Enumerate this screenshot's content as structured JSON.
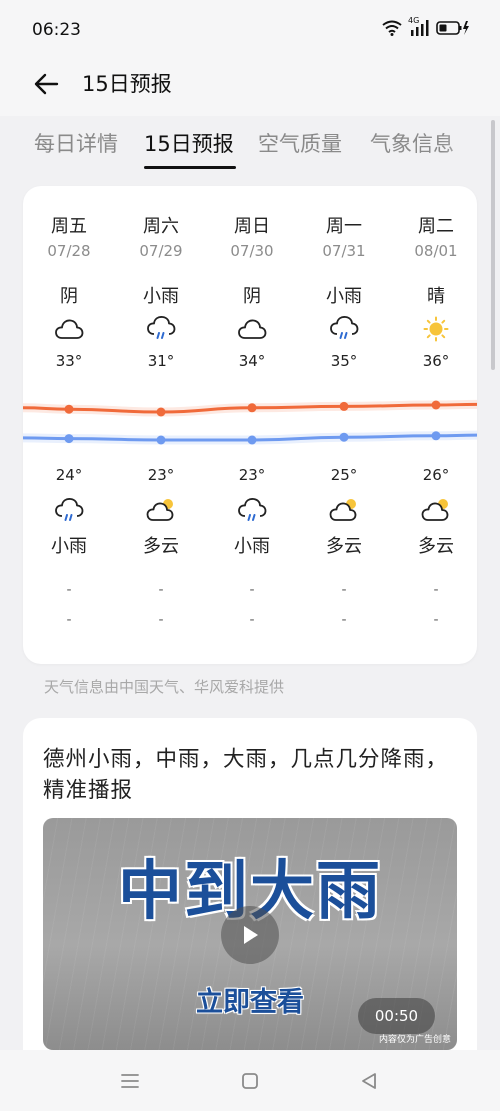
{
  "status_bar": {
    "time": "06:23",
    "network": "4G",
    "wifi_icon": "wifi-icon",
    "signal_icon": "signal-icon",
    "battery_icon": "battery-charging-icon"
  },
  "header": {
    "title": "15日预报",
    "back_icon": "arrow-left-icon"
  },
  "tabs": [
    {
      "label": "每日详情",
      "active": false
    },
    {
      "label": "15日预报",
      "active": true
    },
    {
      "label": "空气质量",
      "active": false
    },
    {
      "label": "气象信息",
      "active": false
    }
  ],
  "forecast": {
    "days": [
      {
        "weekday": "周五",
        "date": "07/28",
        "day_condition": "阴",
        "day_icon": "cloudy-icon",
        "high": "33°",
        "low": "24°",
        "night_icon": "light-rain-icon",
        "night_condition": "小雨",
        "extra1": "-",
        "extra2": "-"
      },
      {
        "weekday": "周六",
        "date": "07/29",
        "day_condition": "小雨",
        "day_icon": "light-rain-icon",
        "high": "31°",
        "low": "23°",
        "night_icon": "partly-cloudy-icon",
        "night_condition": "多云",
        "extra1": "-",
        "extra2": "-"
      },
      {
        "weekday": "周日",
        "date": "07/30",
        "day_condition": "阴",
        "day_icon": "cloudy-icon",
        "high": "34°",
        "low": "23°",
        "night_icon": "light-rain-icon",
        "night_condition": "小雨",
        "extra1": "-",
        "extra2": "-"
      },
      {
        "weekday": "周一",
        "date": "07/31",
        "day_condition": "小雨",
        "day_icon": "light-rain-icon",
        "high": "35°",
        "low": "25°",
        "night_icon": "partly-cloudy-icon",
        "night_condition": "多云",
        "extra1": "-",
        "extra2": "-"
      },
      {
        "weekday": "周二",
        "date": "08/01",
        "day_condition": "晴",
        "day_icon": "sunny-icon",
        "high": "36°",
        "low": "26°",
        "night_icon": "partly-cloudy-icon",
        "night_condition": "多云",
        "extra1": "-",
        "extra2": "-"
      }
    ],
    "colors": {
      "high_line": "#f06a3a",
      "low_line": "#6e9af0",
      "sun": "#f7c43a"
    }
  },
  "source_text": "天气信息由中国天气、华风爱科提供",
  "news": {
    "title": "德州小雨，中雨，大雨，几点几分降雨，精准播报",
    "video": {
      "headline": "中到大雨",
      "subtitle": "立即查看",
      "duration": "00:50",
      "ad_note": "内容仅为广告创意",
      "play_icon": "play-icon",
      "text_color": "#1b4f9a"
    }
  },
  "nav_bar": {
    "icons": [
      "menu-icon",
      "home-icon",
      "back-triangle-icon"
    ]
  }
}
